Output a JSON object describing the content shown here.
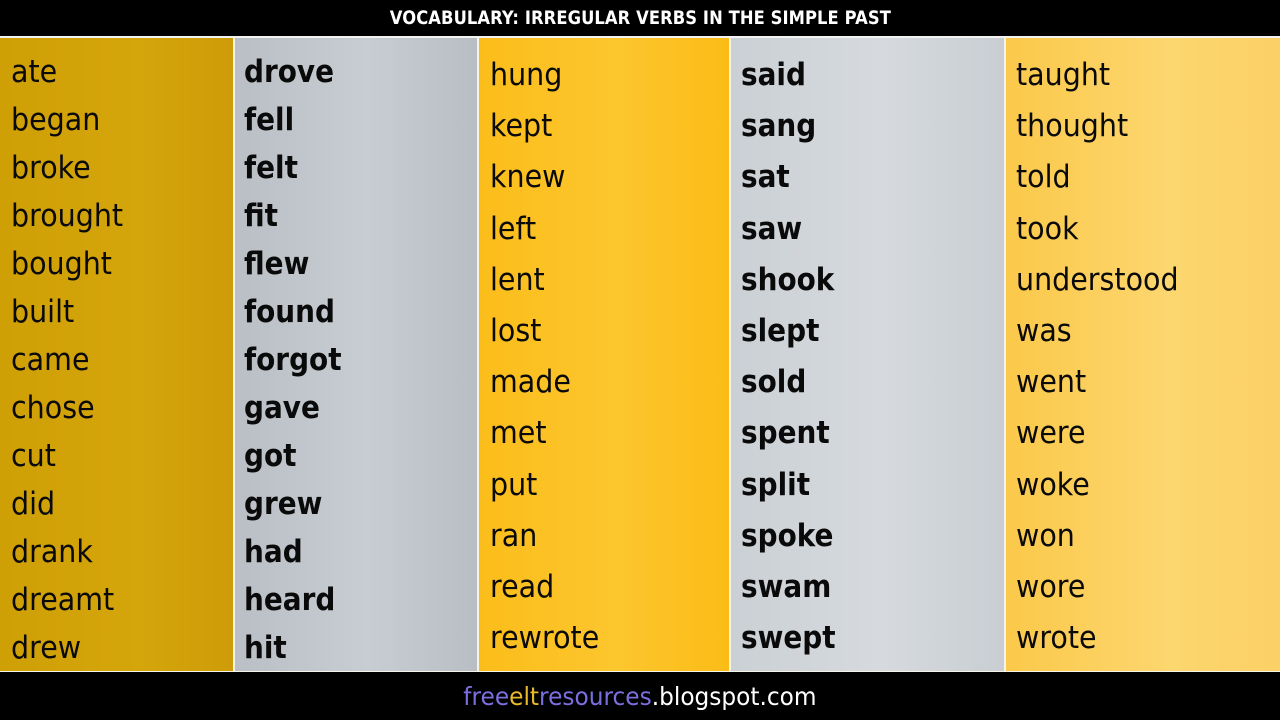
{
  "header": {
    "title": "VOCABULARY: IRREGULAR VERBS IN THE SIMPLE PAST"
  },
  "columns": [
    {
      "style": "regular",
      "background": "#d4a40b",
      "words": [
        "ate",
        "began",
        "broke",
        "brought",
        "bought",
        "built",
        "came",
        "chose",
        "cut",
        "did",
        "drank",
        "dreamt",
        "drew"
      ]
    },
    {
      "style": "bold",
      "background": "#c3c8cd",
      "words": [
        "drove",
        "fell",
        "felt",
        "fit",
        "flew",
        "found",
        "forgot",
        "gave",
        "got",
        "grew",
        "had",
        "heard",
        "hit"
      ]
    },
    {
      "style": "regular",
      "background": "#fcc22a",
      "words": [
        "hung",
        "kept",
        "knew",
        "left",
        "lent",
        "lost",
        "made",
        "met",
        "put",
        "ran",
        "read",
        "rewrote"
      ]
    },
    {
      "style": "bold",
      "background": "#d3d7db",
      "words": [
        "said",
        "sang",
        "sat",
        "saw",
        "shook",
        "slept",
        "sold",
        "spent",
        "split",
        "spoke",
        "swam",
        "swept"
      ]
    },
    {
      "style": "regular",
      "background": "#fcd15f",
      "words": [
        "taught",
        "thought",
        "told",
        "took",
        "understood",
        "was",
        "went",
        "were",
        "woke",
        "won",
        "wore",
        "wrote"
      ]
    }
  ],
  "footer": {
    "parts": [
      {
        "text": "free",
        "color": "#7b6fe0"
      },
      {
        "text": "elt",
        "color": "#e8b92a"
      },
      {
        "text": "resources",
        "color": "#7b6fe0"
      },
      {
        "text": ".blogspot.com",
        "color": "#ffffff"
      }
    ]
  }
}
